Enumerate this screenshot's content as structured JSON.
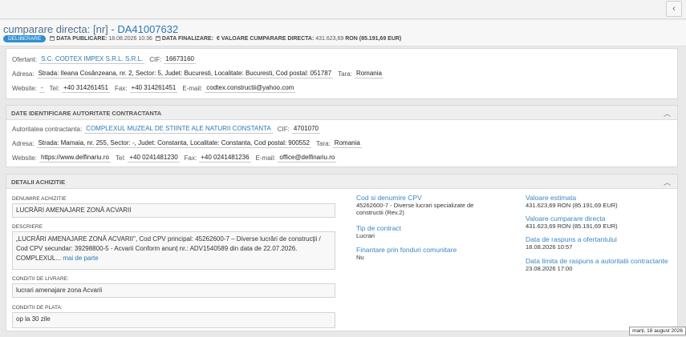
{
  "nav": {
    "back_icon": "‹"
  },
  "header": {
    "title_prefix": "cumparare directa: [nr] - ",
    "title_code": "DA41007632",
    "badge": "DELIBERARE",
    "data_publicare_label": "DATA PUBLICARE:",
    "data_publicare": "18.08.2026 10:36",
    "data_finalizare_label": "DATA FINALIZARE:",
    "valoare_label": "€ VALOARE CUMPARARE DIRECTA:",
    "valoare": "431.623,69",
    "valoare_ron": "RON (85.191,69 EUR)"
  },
  "ofertant": {
    "ofertant_label": "Ofertant:",
    "ofertant": "S.C. CODTEX IMPEX S.R.L. S.R.L.",
    "cif_label": "CIF:",
    "cif": "16673160",
    "adresa_label": "Adresa:",
    "adresa": "Strada: Ileana Cosânzeana, nr. 2, Sector: 5, Judet: Bucuresti, Localitate: Bucuresti, Cod postal: 051787",
    "tara_label": "Tara:",
    "tara": "Romania",
    "website_label": "Website:",
    "website": "-",
    "tel_label": "Tel:",
    "tel": "+40 314261451",
    "fax_label": "Fax:",
    "fax": "+40 314261451",
    "email_label": "E-mail:",
    "email": "codtex.constructii@yahoo.com"
  },
  "autoritate": {
    "header": "DATE IDENTIFICARE AUTORITATE CONTRACTANTA",
    "autoritate_label": "Autoritatea contractanta:",
    "autoritate": "COMPLEXUL MUZEAL DE STIINTE ALE NATURII CONSTANTA",
    "cif_label": "CIF:",
    "cif": "4701070",
    "adresa_label": "Adresa:",
    "adresa": "Strada: Mamaia, nr. 255, Sector: -, Judet: Constanta, Localitate: Constanta, Cod postal: 900552",
    "tara_label": "Tara:",
    "tara": "Romania",
    "website_label": "Website:",
    "website": "https://www.delfinariu.ro",
    "tel_label": "Tel:",
    "tel": "+40 0241481230",
    "fax_label": "Fax:",
    "fax": "+40 0241481236",
    "email_label": "E-mail:",
    "email": "office@delfinariu.ro"
  },
  "achizitie": {
    "header": "DETALII ACHIZITIE",
    "denumire_label": "DENUMIRE ACHIZITIE",
    "denumire": "LUCRĂRI AMENAJARE ZONĂ ACVARII",
    "descriere_label": "DESCRIERE",
    "descriere": "„LUCRĂRI AMENAJARE ZONĂ ACVARII\", Cod CPV principal: 45262600-7 – Diverse lucrări de construcţii / Cod CPV secundar: 39298800-5 - Acvarii Conform anunț nr.: ADV1540589 din data de 22.07.2026. COMPLEXUL...",
    "mai_mult": "mai de parte",
    "livrare_label": "CONDITII DE LIVRARE:",
    "livrare": "lucrari amenajare zona Acvarii",
    "plata_label": "CONDITII DE PLATA:",
    "plata": "op la 30 zile",
    "cpv_label": "Cod si denumire CPV",
    "cpv": "45262600-7 - Diverse lucrari specializate de constructii (Rev.2)",
    "tip_label": "Tip de contract",
    "tip": "Lucrari",
    "finantare_label": "Finantare prin fonduri comunitare",
    "finantare": "Nu",
    "val_estimata_label": "Valoare estimata",
    "val_estimata": "431.623,69 RON (85.191,69 EUR)",
    "val_cumparare_label": "Valoare cumparare directa",
    "val_cumparare": "431.623,69 RON (85.191,69 EUR)",
    "raspuns_ofertant_label": "Data de raspuns a ofertantului",
    "raspuns_ofertant": "18.08.2026 10:57",
    "raspuns_autoritate_label": "Data limita de raspuns a autoritatii contractante",
    "raspuns_autoritate": "23.08.2026 17:00",
    "collapse_icon": "︿"
  },
  "tooltip": "marți, 18 august 2026"
}
